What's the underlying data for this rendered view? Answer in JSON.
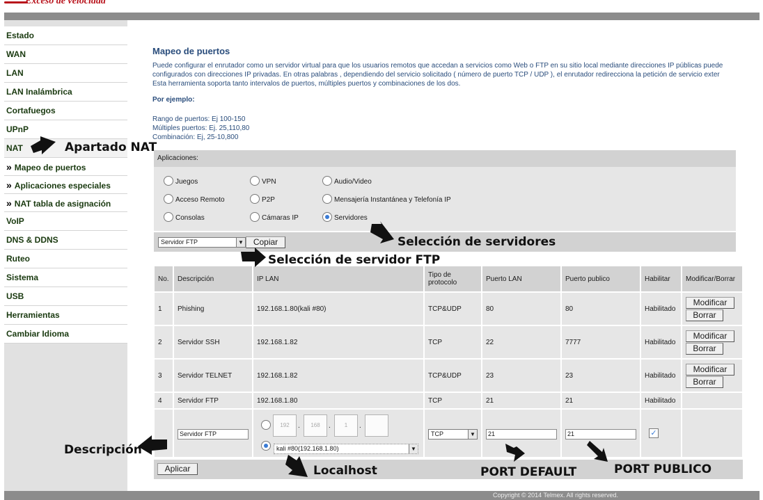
{
  "brand": {
    "logo_text": "Exceso de velocidad"
  },
  "sidebar": {
    "items": [
      {
        "label": "Estado"
      },
      {
        "label": "WAN"
      },
      {
        "label": "LAN"
      },
      {
        "label": "LAN Inalámbrica"
      },
      {
        "label": "Cortafuegos"
      },
      {
        "label": "UPnP"
      },
      {
        "label": "NAT"
      }
    ],
    "sub_items": [
      {
        "label": "Mapeo de puertos"
      },
      {
        "label": "Aplicaciones especiales"
      },
      {
        "label": "NAT tabla de asignación"
      }
    ],
    "items_after": [
      {
        "label": "VoIP"
      },
      {
        "label": "DNS & DDNS"
      },
      {
        "label": "Ruteo"
      },
      {
        "label": "Sistema"
      },
      {
        "label": "USB"
      },
      {
        "label": "Herramientas"
      },
      {
        "label": "Cambiar Idioma"
      }
    ],
    "sub_marker": "»"
  },
  "main": {
    "title": "Mapeo de puertos",
    "description": [
      "Puede configurar el enrutador como un servidor virtual para que los usuarios remotos que accedan a servicios como Web o FTP en su sitio local mediante direcciones IP públicas puede",
      "configurados con direcciones IP privadas. En otras palabras , dependiendo del servicio solicitado ( número de puerto TCP / UDP ), el enrutador redirecciona la petición de servicio exter",
      "Esta herramienta soporta tanto intervalos de puertos, múltiples puertos y combinaciones de los dos."
    ],
    "example_title": "Por ejemplo:",
    "examples": [
      "Rango de puertos: Ej 100-150",
      "Múltiples puertos: Ej. 25,110,80",
      "Combinación: Ej, 25-10,800"
    ]
  },
  "apps": {
    "title": "Aplicaciones:",
    "options": [
      {
        "label": "Juegos",
        "selected": false
      },
      {
        "label": "VPN",
        "selected": false
      },
      {
        "label": "Audio/Video",
        "selected": false
      },
      {
        "label": "Acceso Remoto",
        "selected": false
      },
      {
        "label": "P2P",
        "selected": false
      },
      {
        "label": "Mensajería Instantánea y Telefonía IP",
        "selected": false
      },
      {
        "label": "Consolas",
        "selected": false
      },
      {
        "label": "Cámaras IP",
        "selected": false
      },
      {
        "label": "Servidores",
        "selected": true
      }
    ],
    "server_select": "Servidor FTP",
    "copy_label": "Copiar"
  },
  "table": {
    "headers": [
      "No.",
      "Descripción",
      "IP LAN",
      "Tipo de protocolo",
      "Puerto LAN",
      "Puerto publico",
      "Habilitar",
      "Modificar/Borrar"
    ],
    "rows": [
      {
        "no": "1",
        "desc": "Phishing",
        "ip": "192.168.1.80(kali #80)",
        "proto": "TCP&UDP",
        "lan": "80",
        "pub": "80",
        "enabled": "Habilitado"
      },
      {
        "no": "2",
        "desc": "Servidor SSH",
        "ip": "192.168.1.82",
        "proto": "TCP",
        "lan": "22",
        "pub": "7777",
        "enabled": "Habilitado"
      },
      {
        "no": "3",
        "desc": "Servidor TELNET",
        "ip": "192.168.1.82",
        "proto": "TCP&UDP",
        "lan": "23",
        "pub": "23",
        "enabled": "Habilitado"
      },
      {
        "no": "4",
        "desc": "Servidor FTP",
        "ip": "192.168.1.80",
        "proto": "TCP",
        "lan": "21",
        "pub": "21",
        "enabled": "Habilitado"
      }
    ],
    "modify_label": "Modificar",
    "delete_label": "Borrar",
    "edit": {
      "desc_value": "Servidor FTP",
      "ip_octets": [
        "192",
        "168",
        "1",
        ""
      ],
      "ip_dot": ".",
      "host_select": "kali #80(192.168.1.80)",
      "proto_select": "TCP",
      "lan_port": "21",
      "pub_port": "21",
      "enable_checked": true,
      "check_glyph": "✓"
    },
    "apply_label": "Aplicar"
  },
  "footer": {
    "text": "Copyright © 2014 Telmex. All rights reserved."
  },
  "annotations": {
    "nat": "Apartado NAT",
    "servers": "Selección de servidores",
    "ftp": "Selección de servidor FTP",
    "description": "Descripción",
    "localhost": "Localhost",
    "port_default": "PORT DEFAULT",
    "port_public": "PORT PUBLICO"
  },
  "colors": {
    "accent": "#2a4d7c",
    "brand": "#b8121b",
    "nav_text": "#1a3a10"
  }
}
